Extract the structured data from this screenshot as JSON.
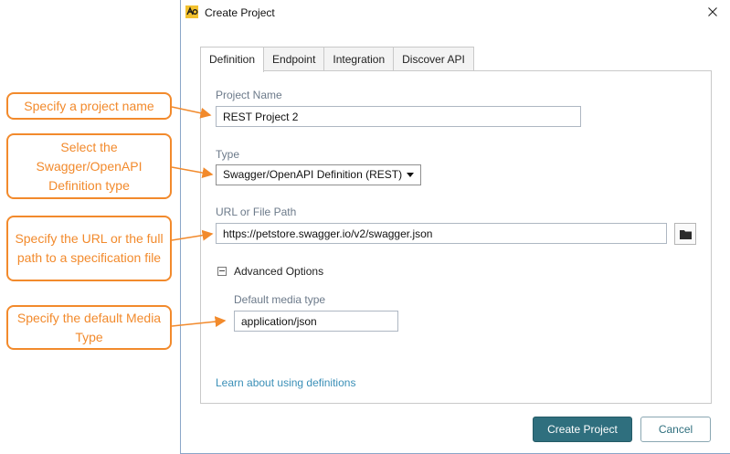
{
  "window": {
    "title": "Create Project"
  },
  "tabs": [
    {
      "label": "Definition",
      "active": true
    },
    {
      "label": "Endpoint",
      "active": false
    },
    {
      "label": "Integration",
      "active": false
    },
    {
      "label": "Discover API",
      "active": false
    }
  ],
  "form": {
    "project_name_label": "Project Name",
    "project_name_value": "REST Project 2",
    "type_label": "Type",
    "type_value": "Swagger/OpenAPI Definition (REST)",
    "url_label": "URL or File Path",
    "url_value": "https://petstore.swagger.io/v2/swagger.json",
    "advanced_label": "Advanced Options",
    "media_type_label": "Default media type",
    "media_type_value": "application/json",
    "learn_link": "Learn about using definitions"
  },
  "buttons": {
    "create": "Create Project",
    "cancel": "Cancel"
  },
  "callouts": {
    "project_name": "Specify a project name",
    "type": "Select the Swagger/OpenAPI Definition type",
    "url": "Specify the URL or the full path to a specification file",
    "media_type": "Specify the default Media Type"
  },
  "icons": {
    "app": "app-logo-icon",
    "close": "close-icon",
    "browse": "folder-icon",
    "collapse": "collapse-icon",
    "dropdown": "chevron-down-icon"
  },
  "colors": {
    "accent": "#2f6f7e",
    "callout": "#f28a2c",
    "link": "#3a8fb7"
  }
}
